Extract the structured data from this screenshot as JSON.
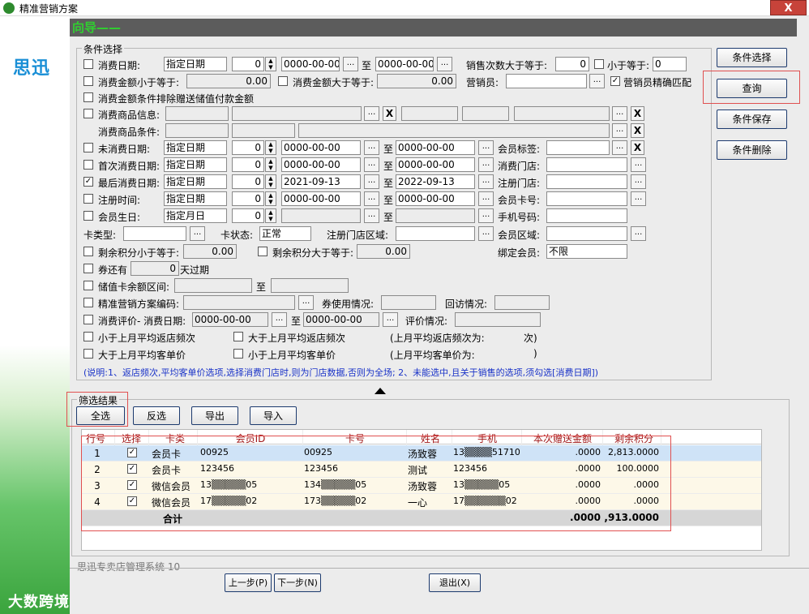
{
  "window": {
    "title": "精准营销方案",
    "close": "X"
  },
  "sidebar": {
    "logo": "思迅"
  },
  "guide": {
    "title": "向导——"
  },
  "conditions": {
    "title": "条件选择",
    "r1": {
      "label": "消费日期:",
      "mode": "指定日期",
      "num": "0",
      "from": "0000-00-00",
      "to_label": "至",
      "to": "0000-00-00",
      "count_label": "销售次数大于等于:",
      "count_val": "0",
      "less_label": "小于等于:",
      "less_val": "0"
    },
    "r2": {
      "label": "消费金额小于等于:",
      "val": "0.00",
      "label2": "消费金额大于等于:",
      "val2": "0.00",
      "clerk_label": "营销员:",
      "clerk_match": "营销员精确匹配"
    },
    "r3": {
      "label": "消费金额条件排除赠送储值付款金额"
    },
    "r4": {
      "label": "消费商品信息:"
    },
    "r5": {
      "label": "消费商品条件:"
    },
    "r6": {
      "label": "未消费日期:",
      "mode": "指定日期",
      "num": "0",
      "from": "0000-00-00",
      "to_label": "至",
      "to": "0000-00-00",
      "right_label": "会员标签:"
    },
    "r7": {
      "label": "首次消费日期:",
      "mode": "指定日期",
      "num": "0",
      "from": "0000-00-00",
      "to_label": "至",
      "to": "0000-00-00",
      "right_label": "消费门店:"
    },
    "r8": {
      "label": "最后消费日期:",
      "mode": "指定日期",
      "num": "0",
      "from": "2021-09-13",
      "to_label": "至",
      "to": "2022-09-13",
      "right_label": "注册门店:"
    },
    "r9": {
      "label": "注册时间:",
      "mode": "指定日期",
      "num": "0",
      "from": "0000-00-00",
      "to_label": "至",
      "to": "0000-00-00",
      "right_label": "会员卡号:"
    },
    "r10": {
      "label": "会员生日:",
      "mode": "指定月日",
      "num": "0",
      "to_label": "至",
      "right_label": "手机号码:"
    },
    "r11": {
      "card_type": "卡类型:",
      "card_state": "卡状态:",
      "card_state_val": "正常",
      "reg_area": "注册门店区域:",
      "member_area": "会员区域:"
    },
    "r12": {
      "label": "剩余积分小于等于:",
      "val": "0.00",
      "label2": "剩余积分大于等于:",
      "val2": "0.00",
      "bind_label": "绑定会员:",
      "bind_val": "不限"
    },
    "r13": {
      "label": "券还有",
      "val": "0",
      "suffix": "天过期"
    },
    "r14": {
      "label": "储值卡余额区间:",
      "to_label": "至"
    },
    "r15": {
      "label": "精准营销方案编码:",
      "coupon_label": "券使用情况:",
      "visit_label": "回访情况:"
    },
    "r16": {
      "label": "消费评价- 消费日期:",
      "from": "0000-00-00",
      "to_label": "至",
      "to": "0000-00-00",
      "eval_label": "评价情况:"
    },
    "r17": {
      "a": "小于上月平均返店频次",
      "b": "大于上月平均返店频次",
      "c": "(上月平均返店频次为:",
      "c2": "次)"
    },
    "r18": {
      "a": "大于上月平均客单价",
      "b": "小于上月平均客单价",
      "c": "(上月平均客单价为:",
      "c2": ")"
    },
    "note": "(说明:1、返店频次,平均客单价选项,选择消费门店时,则为门店数据,否则为全场; 2、未能选中,且关于销售的选项,须勾选[消费日期])"
  },
  "side_buttons": {
    "select": "条件选择",
    "query": "查询",
    "save": "条件保存",
    "delete": "条件删除"
  },
  "results": {
    "title": "筛选结果",
    "buttons": {
      "all": "全选",
      "invert": "反选",
      "export": "导出",
      "import": "导入"
    },
    "columns": [
      "行号",
      "选择",
      "卡类",
      "会员ID",
      "卡号",
      "姓名",
      "手机",
      "本次赠送金额",
      "剩余积分"
    ],
    "rows": [
      {
        "no": "1",
        "card_type": "会员卡",
        "member_id": "00925",
        "card_no": "00925",
        "name": "汤致蓉",
        "phone": "13▒▒▒▒51710",
        "gift": ".0000",
        "points": "2,813.0000"
      },
      {
        "no": "2",
        "card_type": "会员卡",
        "member_id": "123456",
        "card_no": "123456",
        "name": "测试",
        "phone": "123456",
        "gift": ".0000",
        "points": "100.0000"
      },
      {
        "no": "3",
        "card_type": "微信会员",
        "member_id": "13▒▒▒▒▒05",
        "card_no": "134▒▒▒▒▒05",
        "name": "汤致蓉",
        "phone": "13▒▒▒▒▒05",
        "gift": ".0000",
        "points": ".0000"
      },
      {
        "no": "4",
        "card_type": "微信会员",
        "member_id": "17▒▒▒▒▒02",
        "card_no": "173▒▒▒▒▒02",
        "name": "一心",
        "phone": "17▒▒▒▒▒▒02",
        "gift": ".0000",
        "points": ".0000"
      }
    ],
    "total_label": "合计",
    "total_gift": ".0000",
    "total_points": ",913.0000"
  },
  "footer": {
    "text": "思迅专卖店管理系统 10",
    "prev": "上一步(P)",
    "next": "下一步(N)",
    "exit": "退出(X)"
  },
  "watermark": "大数跨境",
  "colors": {
    "guide_text": "#30d030",
    "note": "#1a33c8",
    "selected_row": "#cfe3f7",
    "header_text": "#a01818",
    "highlight": "#e05050"
  }
}
